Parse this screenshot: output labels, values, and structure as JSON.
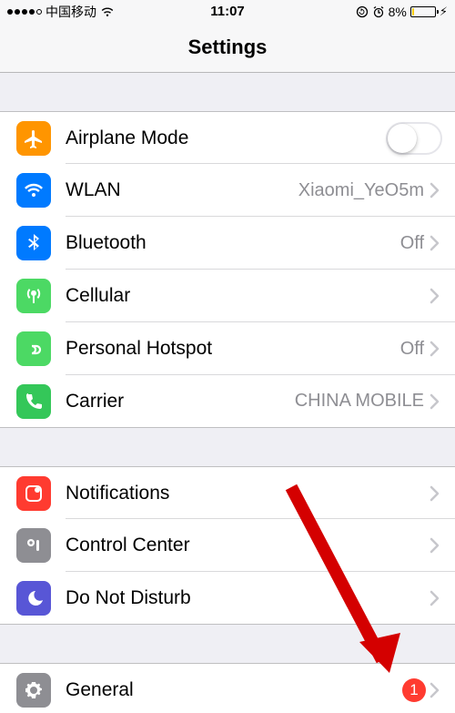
{
  "status": {
    "carrier": "中国移动",
    "time": "11:07",
    "battery_percent": "8%",
    "battery_level_pct": 8
  },
  "title": "Settings",
  "groups": [
    {
      "rows": [
        {
          "key": "airplane",
          "label": "Airplane Mode",
          "detail": "",
          "kind": "switch",
          "switch_on": false
        },
        {
          "key": "wlan",
          "label": "WLAN",
          "detail": "Xiaomi_YeO5m"
        },
        {
          "key": "bt",
          "label": "Bluetooth",
          "detail": "Off"
        },
        {
          "key": "cell",
          "label": "Cellular",
          "detail": ""
        },
        {
          "key": "hotspot",
          "label": "Personal Hotspot",
          "detail": "Off"
        },
        {
          "key": "carrier",
          "label": "Carrier",
          "detail": "CHINA MOBILE"
        }
      ]
    },
    {
      "rows": [
        {
          "key": "notif",
          "label": "Notifications",
          "detail": ""
        },
        {
          "key": "cc",
          "label": "Control Center",
          "detail": ""
        },
        {
          "key": "dnd",
          "label": "Do Not Disturb",
          "detail": ""
        }
      ]
    },
    {
      "rows": [
        {
          "key": "general",
          "label": "General",
          "detail": "",
          "badge": "1"
        }
      ]
    }
  ]
}
